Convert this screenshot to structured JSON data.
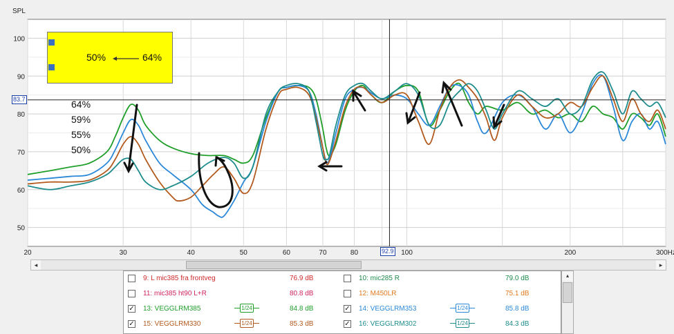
{
  "chart_data": {
    "type": "line",
    "ylabel": "SPL",
    "xunit": "Hz",
    "x_scale": "log",
    "xlim": [
      20,
      300
    ],
    "ylim": [
      45,
      105
    ],
    "yticks": [
      50,
      60,
      70,
      80,
      90,
      100
    ],
    "xticks": [
      20,
      30,
      40,
      50,
      60,
      70,
      80,
      100,
      200,
      300
    ],
    "xtick_labels": [
      "20",
      "30",
      "40",
      "50",
      "60",
      "70",
      "80",
      "100",
      "200",
      "300Hz"
    ],
    "grid": true,
    "cursor": {
      "x": 92.9,
      "y": 83.7,
      "x_label": "92.9",
      "y_label": "83.7"
    },
    "series": [
      {
        "name": "13: VEGGLRM385",
        "color": "#1f9e2a",
        "points": [
          [
            20,
            64
          ],
          [
            22,
            65
          ],
          [
            24,
            66
          ],
          [
            26,
            67
          ],
          [
            28,
            70
          ],
          [
            29,
            74
          ],
          [
            30,
            79
          ],
          [
            31,
            82.5
          ],
          [
            32,
            81
          ],
          [
            33,
            77
          ],
          [
            35,
            73
          ],
          [
            37,
            71
          ],
          [
            40,
            69.5
          ],
          [
            43,
            69
          ],
          [
            46,
            69
          ],
          [
            48,
            68
          ],
          [
            50,
            67
          ],
          [
            52,
            69
          ],
          [
            55,
            79
          ],
          [
            58,
            86
          ],
          [
            60,
            87
          ],
          [
            63,
            87.5
          ],
          [
            66,
            87
          ],
          [
            68,
            84
          ],
          [
            70,
            76
          ],
          [
            71,
            71
          ],
          [
            72,
            69
          ],
          [
            74,
            72
          ],
          [
            77,
            81
          ],
          [
            80,
            86
          ],
          [
            83,
            87.5
          ],
          [
            86,
            85
          ],
          [
            90,
            83
          ],
          [
            95,
            86
          ],
          [
            100,
            87.5
          ],
          [
            105,
            86
          ],
          [
            110,
            77
          ],
          [
            115,
            81
          ],
          [
            120,
            86
          ],
          [
            125,
            88
          ],
          [
            130,
            83
          ],
          [
            135,
            80
          ],
          [
            140,
            82
          ],
          [
            150,
            81
          ],
          [
            160,
            83
          ],
          [
            170,
            80
          ],
          [
            180,
            81
          ],
          [
            190,
            79
          ],
          [
            200,
            80
          ],
          [
            210,
            78
          ],
          [
            220,
            82
          ],
          [
            230,
            80
          ],
          [
            240,
            79
          ],
          [
            250,
            76
          ],
          [
            260,
            80
          ],
          [
            270,
            79
          ],
          [
            280,
            77
          ],
          [
            290,
            80
          ],
          [
            300,
            74
          ]
        ]
      },
      {
        "name": "14: VEGGLRM353",
        "color": "#2b88d8",
        "points": [
          [
            20,
            62.5
          ],
          [
            22,
            63
          ],
          [
            24,
            63.5
          ],
          [
            26,
            64
          ],
          [
            28,
            67
          ],
          [
            29,
            70.5
          ],
          [
            30,
            75
          ],
          [
            31,
            78.5
          ],
          [
            32,
            77
          ],
          [
            33,
            73
          ],
          [
            35,
            67
          ],
          [
            37,
            64
          ],
          [
            40,
            60
          ],
          [
            42,
            56
          ],
          [
            44,
            54
          ],
          [
            45,
            53
          ],
          [
            46,
            53
          ],
          [
            48,
            57
          ],
          [
            50,
            62
          ],
          [
            52,
            66
          ],
          [
            55,
            78
          ],
          [
            58,
            86
          ],
          [
            60,
            87
          ],
          [
            63,
            87.5
          ],
          [
            66,
            86
          ],
          [
            68,
            80
          ],
          [
            70,
            71
          ],
          [
            71,
            67.5
          ],
          [
            72,
            68
          ],
          [
            74,
            75
          ],
          [
            77,
            84
          ],
          [
            80,
            86.5
          ],
          [
            83,
            87
          ],
          [
            86,
            85.5
          ],
          [
            90,
            84
          ],
          [
            95,
            85
          ],
          [
            100,
            84
          ],
          [
            105,
            80
          ],
          [
            110,
            77
          ],
          [
            115,
            82
          ],
          [
            120,
            87
          ],
          [
            125,
            87.5
          ],
          [
            130,
            85
          ],
          [
            135,
            78
          ],
          [
            140,
            75
          ],
          [
            150,
            83
          ],
          [
            160,
            85
          ],
          [
            170,
            82
          ],
          [
            180,
            76
          ],
          [
            190,
            80
          ],
          [
            200,
            75
          ],
          [
            210,
            80
          ],
          [
            220,
            88
          ],
          [
            230,
            90
          ],
          [
            240,
            82
          ],
          [
            250,
            73
          ],
          [
            260,
            78
          ],
          [
            270,
            80
          ],
          [
            280,
            76
          ],
          [
            290,
            78
          ],
          [
            300,
            72
          ]
        ]
      },
      {
        "name": "15: VEGGLRM330",
        "color": "#b25a1e",
        "points": [
          [
            20,
            61.5
          ],
          [
            22,
            62
          ],
          [
            24,
            62
          ],
          [
            26,
            62.5
          ],
          [
            28,
            65
          ],
          [
            29,
            68
          ],
          [
            30,
            72
          ],
          [
            31,
            74
          ],
          [
            32,
            72
          ],
          [
            33,
            68
          ],
          [
            35,
            62
          ],
          [
            37,
            58
          ],
          [
            38,
            57
          ],
          [
            40,
            58
          ],
          [
            42,
            61
          ],
          [
            44,
            64
          ],
          [
            46,
            66
          ],
          [
            48,
            63
          ],
          [
            50,
            59
          ],
          [
            52,
            62
          ],
          [
            55,
            76
          ],
          [
            58,
            85
          ],
          [
            60,
            86.5
          ],
          [
            63,
            87
          ],
          [
            66,
            85
          ],
          [
            68,
            79
          ],
          [
            70,
            71
          ],
          [
            71,
            67
          ],
          [
            72,
            67.5
          ],
          [
            74,
            73
          ],
          [
            77,
            82
          ],
          [
            80,
            86.5
          ],
          [
            83,
            87
          ],
          [
            86,
            85
          ],
          [
            90,
            83
          ],
          [
            95,
            85
          ],
          [
            100,
            85
          ],
          [
            105,
            78
          ],
          [
            110,
            72
          ],
          [
            115,
            81
          ],
          [
            120,
            87
          ],
          [
            125,
            89
          ],
          [
            130,
            87
          ],
          [
            135,
            84
          ],
          [
            140,
            79
          ],
          [
            145,
            73
          ],
          [
            150,
            79
          ],
          [
            160,
            85
          ],
          [
            170,
            82
          ],
          [
            180,
            79
          ],
          [
            190,
            80
          ],
          [
            200,
            83
          ],
          [
            210,
            82
          ],
          [
            220,
            87
          ],
          [
            230,
            90
          ],
          [
            240,
            84
          ],
          [
            250,
            78
          ],
          [
            260,
            84
          ],
          [
            270,
            80
          ],
          [
            280,
            78
          ],
          [
            290,
            81
          ],
          [
            300,
            76
          ]
        ]
      },
      {
        "name": "16: VEGGLRM302",
        "color": "#1e8c8c",
        "points": [
          [
            20,
            61
          ],
          [
            22,
            60
          ],
          [
            24,
            61
          ],
          [
            26,
            62
          ],
          [
            28,
            64
          ],
          [
            29,
            66
          ],
          [
            30,
            68
          ],
          [
            31,
            68
          ],
          [
            32,
            65
          ],
          [
            33,
            62
          ],
          [
            35,
            60
          ],
          [
            37,
            61
          ],
          [
            40,
            63.5
          ],
          [
            43,
            67
          ],
          [
            46,
            68.5
          ],
          [
            48,
            67
          ],
          [
            50,
            63
          ],
          [
            52,
            66
          ],
          [
            55,
            80
          ],
          [
            58,
            86
          ],
          [
            60,
            87.5
          ],
          [
            63,
            88
          ],
          [
            66,
            86
          ],
          [
            68,
            78
          ],
          [
            70,
            69
          ],
          [
            71,
            68
          ],
          [
            72,
            69
          ],
          [
            74,
            77
          ],
          [
            77,
            85
          ],
          [
            80,
            87.5
          ],
          [
            83,
            88
          ],
          [
            86,
            86
          ],
          [
            90,
            84
          ],
          [
            95,
            86
          ],
          [
            100,
            88
          ],
          [
            105,
            85
          ],
          [
            110,
            77
          ],
          [
            115,
            77
          ],
          [
            120,
            83
          ],
          [
            125,
            86
          ],
          [
            130,
            88
          ],
          [
            135,
            86
          ],
          [
            140,
            81
          ],
          [
            145,
            76
          ],
          [
            150,
            80
          ],
          [
            160,
            86
          ],
          [
            170,
            84
          ],
          [
            180,
            82
          ],
          [
            190,
            84
          ],
          [
            200,
            80
          ],
          [
            210,
            82
          ],
          [
            220,
            89
          ],
          [
            230,
            91
          ],
          [
            240,
            86
          ],
          [
            250,
            80
          ],
          [
            260,
            86
          ],
          [
            270,
            84
          ],
          [
            280,
            82
          ],
          [
            290,
            83
          ],
          [
            300,
            79
          ]
        ]
      }
    ]
  },
  "annotations": {
    "box_from": "50%",
    "box_to": "64%",
    "percent_labels": [
      "64%",
      "59%",
      "55%",
      "50%"
    ]
  },
  "legend": [
    {
      "label": "9: L mic385 fra frontveg",
      "value": "76.9 dB",
      "checked": false,
      "color": "#d02a2a",
      "smoothing": ""
    },
    {
      "label": "10: mic285 R",
      "value": "79.0 dB",
      "checked": false,
      "color": "#1f8a4d",
      "smoothing": ""
    },
    {
      "label": "11: mic385 ht90 L+R",
      "value": "80.8 dB",
      "checked": false,
      "color": "#d0245e",
      "smoothing": ""
    },
    {
      "label": "12: M450LR",
      "value": "75.1 dB",
      "checked": false,
      "color": "#e07a20",
      "smoothing": ""
    },
    {
      "label": "13: VEGGLRM385",
      "value": "84.8 dB",
      "checked": true,
      "color": "#1f9e2a",
      "smoothing": "1/24"
    },
    {
      "label": "14: VEGGLRM353",
      "value": "85.8 dB",
      "checked": true,
      "color": "#2b88d8",
      "smoothing": "1/24"
    },
    {
      "label": "15: VEGGLRM330",
      "value": "85.3 dB",
      "checked": true,
      "color": "#b25a1e",
      "smoothing": "1/24"
    },
    {
      "label": "16: VEGGLRM302",
      "value": "84.3 dB",
      "checked": true,
      "color": "#1e8c8c",
      "smoothing": "1/24"
    }
  ],
  "scroll": {
    "left_arrow": "◂",
    "right_arrow": "▸",
    "up_arrow": "▴"
  }
}
